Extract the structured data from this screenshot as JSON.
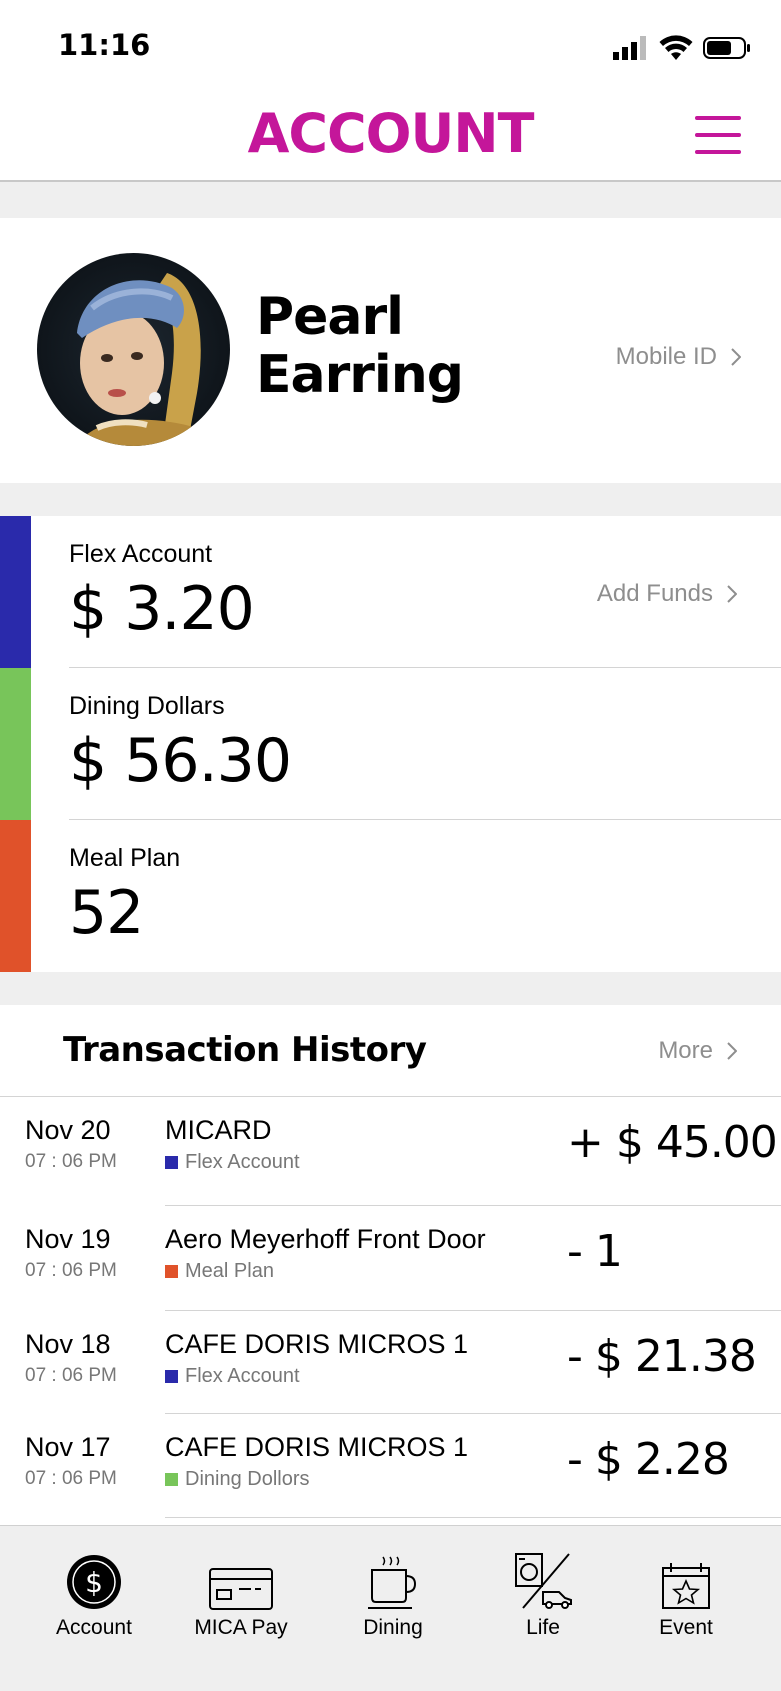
{
  "status_bar": {
    "time": "11:16"
  },
  "header": {
    "title": "ACCOUNT"
  },
  "profile": {
    "name_line1": "Pearl",
    "name_line2": "Earring",
    "mobile_id_label": "Mobile ID"
  },
  "balances": [
    {
      "label": "Flex Account",
      "value": "$ 3.20",
      "color": "#2a2aab",
      "action": "Add Funds"
    },
    {
      "label": "Dining Dollars",
      "value": "$ 56.30",
      "color": "#78c55a"
    },
    {
      "label": "Meal Plan",
      "value": "52",
      "color": "#e0522a"
    }
  ],
  "transactions": {
    "title": "Transaction History",
    "more_label": "More",
    "rows": [
      {
        "date": "Nov 20",
        "time": "07 : 06 PM",
        "name": "MICARD",
        "account": "Flex Account",
        "account_color": "#2a2aab",
        "amount": "+ $ 45.00"
      },
      {
        "date": "Nov 19",
        "time": "07 : 06 PM",
        "name": "Aero Meyerhoff Front Door",
        "account": "Meal Plan",
        "account_color": "#e0522a",
        "amount": "- 1"
      },
      {
        "date": "Nov 18",
        "time": "07 : 06 PM",
        "name": "CAFE DORIS MICROS 1",
        "account": "Flex Account",
        "account_color": "#2a2aab",
        "amount": "- $ 21.38"
      },
      {
        "date": "Nov 17",
        "time": "07 : 06 PM",
        "name": "CAFE DORIS MICROS 1",
        "account": "Dining Dollors",
        "account_color": "#78c55a",
        "amount": "- $ 2.28"
      }
    ]
  },
  "tabbar": [
    {
      "label": "Account",
      "icon": "dollar-coin-icon"
    },
    {
      "label": "MICA Pay",
      "icon": "card-icon"
    },
    {
      "label": "Dining",
      "icon": "coffee-cup-icon"
    },
    {
      "label": "Life",
      "icon": "laundry-truck-icon"
    },
    {
      "label": "Event",
      "icon": "calendar-star-icon"
    }
  ],
  "colors": {
    "accent": "#c4169a",
    "muted_text": "#8e8e8e"
  }
}
